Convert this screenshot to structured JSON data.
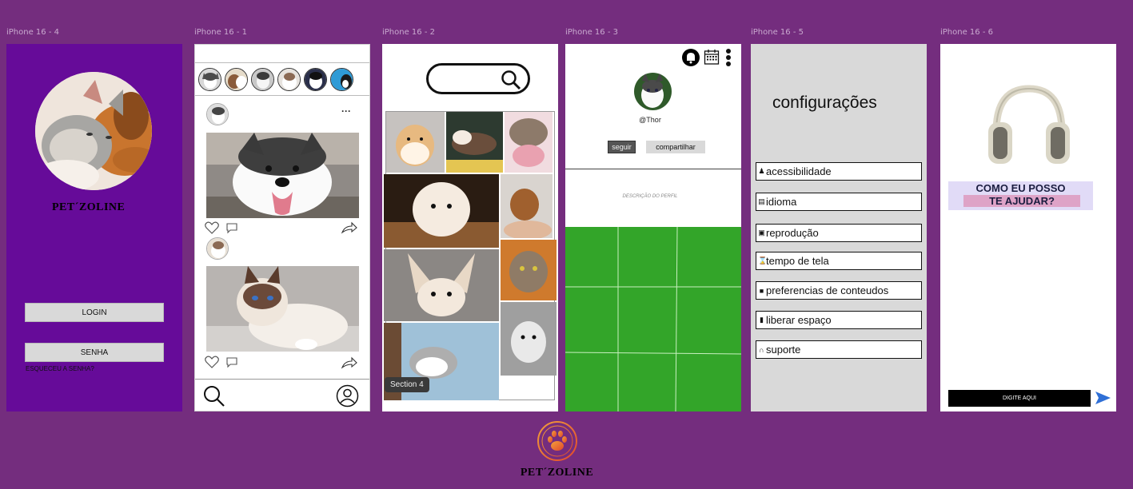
{
  "frames": {
    "f4": "iPhone 16 - 4",
    "f1": "iPhone 16 - 1",
    "f2": "iPhone 16 - 2",
    "f3": "iPhone 16 - 3",
    "f5": "iPhone 16 - 5",
    "f6": "iPhone 16 - 6"
  },
  "login": {
    "brand": "PET´ZOLINE",
    "login_label": "LOGIN",
    "password_label": "SENHA",
    "forgot_label": "ESQUECEU A SENHA?"
  },
  "feed": {
    "more_label": "···",
    "icons": [
      "heart-icon",
      "comment-icon",
      "share-icon",
      "search-icon",
      "profile-icon"
    ]
  },
  "explore": {
    "section_label": "Section 4"
  },
  "profile": {
    "username": "@Thor",
    "follow_label": "seguir",
    "share_label": "compartilhar",
    "description": "DESCRIÇÃO DO PERFIL",
    "grid_color": "#33a529"
  },
  "settings": {
    "title": "configurações",
    "items": [
      {
        "label": "acessibilidade",
        "icon": "person-icon"
      },
      {
        "label": "idioma",
        "icon": "language-icon"
      },
      {
        "label": "reprodução",
        "icon": "play-icon"
      },
      {
        "label": "tempo de tela",
        "icon": "hourglass-icon"
      },
      {
        "label": "preferencias de conteudos",
        "icon": "video-icon"
      },
      {
        "label": "liberar espaço",
        "icon": "trash-icon"
      },
      {
        "label": "suporte",
        "icon": "headphones-icon"
      }
    ]
  },
  "help": {
    "line1": "COMO EU POSSO",
    "line2": "TE AJUDAR?",
    "input_placeholder": "DIGITE AQUI"
  },
  "brand": {
    "name": "PET´ZOLINE",
    "accent": "#e8622c"
  },
  "colors": {
    "background": "#742d7e",
    "login_bg": "#660b99",
    "settings_bg": "#d9d9d9",
    "grid_green": "#33a529"
  }
}
